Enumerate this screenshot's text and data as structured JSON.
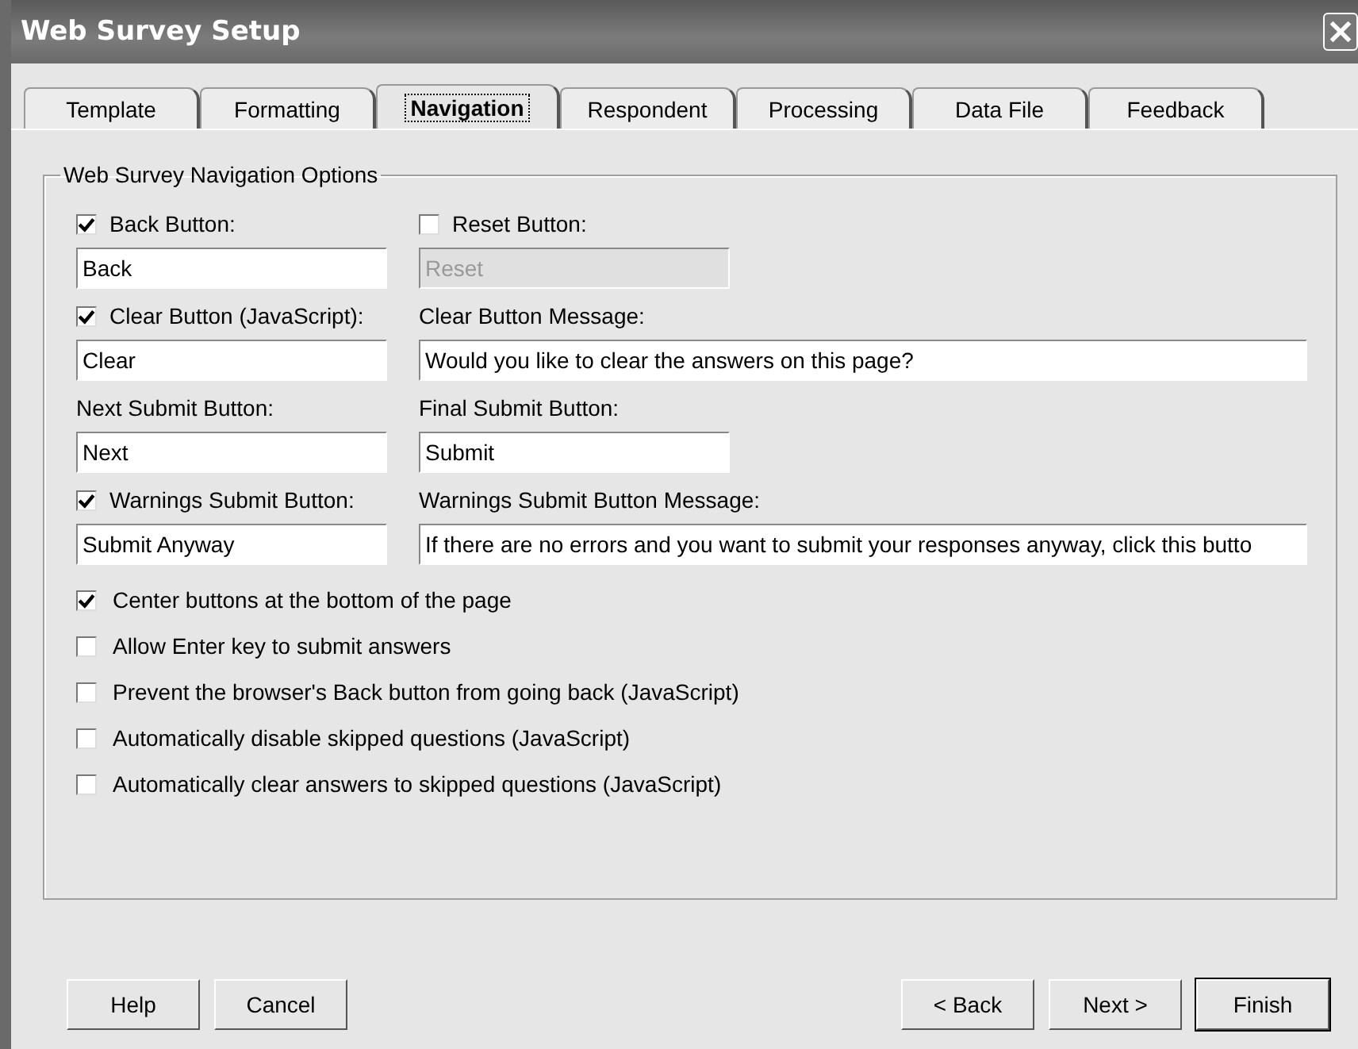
{
  "window": {
    "title": "Web Survey Setup"
  },
  "tabs": [
    {
      "label": "Template",
      "selected": false
    },
    {
      "label": "Formatting",
      "selected": false
    },
    {
      "label": "Navigation",
      "selected": true
    },
    {
      "label": "Respondent",
      "selected": false
    },
    {
      "label": "Processing",
      "selected": false
    },
    {
      "label": "Data File",
      "selected": false
    },
    {
      "label": "Feedback",
      "selected": false
    }
  ],
  "group": {
    "title": "Web Survey Navigation Options",
    "rows": [
      {
        "left": {
          "label": "Back Button:",
          "kind": "checkbox",
          "checked": true,
          "value": "Back",
          "disabled": false,
          "wide": false
        },
        "right": {
          "label": "Reset Button:",
          "kind": "checkbox",
          "checked": false,
          "value": "Reset",
          "disabled": true,
          "wide": false
        }
      },
      {
        "left": {
          "label": "Clear Button (JavaScript):",
          "kind": "checkbox",
          "checked": true,
          "value": "Clear",
          "disabled": false,
          "wide": false
        },
        "right": {
          "label": "Clear Button Message:",
          "kind": "label",
          "value": "Would you like to clear the answers on this page?",
          "disabled": false,
          "wide": true
        }
      },
      {
        "left": {
          "label": "Next Submit Button:",
          "kind": "label",
          "value": "Next",
          "disabled": false,
          "wide": false
        },
        "right": {
          "label": "Final Submit Button:",
          "kind": "label",
          "value": "Submit",
          "disabled": false,
          "wide": false
        }
      },
      {
        "left": {
          "label": "Warnings Submit Button:",
          "kind": "checkbox",
          "checked": true,
          "value": "Submit Anyway",
          "disabled": false,
          "wide": false
        },
        "right": {
          "label": "Warnings Submit Button Message:",
          "kind": "label",
          "value": "If there are no errors and you want to submit your responses anyway, click this butto",
          "disabled": false,
          "wide": true
        }
      }
    ],
    "options": [
      {
        "label": "Center buttons at the bottom of the page",
        "checked": true
      },
      {
        "label": "Allow Enter key to submit answers",
        "checked": false
      },
      {
        "label": "Prevent the browser's Back button from going back (JavaScript)",
        "checked": false
      },
      {
        "label": "Automatically disable skipped questions (JavaScript)",
        "checked": false
      },
      {
        "label": "Automatically clear answers to skipped questions (JavaScript)",
        "checked": false
      }
    ]
  },
  "buttons_left": [
    {
      "label": "Help",
      "default": false
    },
    {
      "label": "Cancel",
      "default": false
    }
  ],
  "buttons_right": [
    {
      "label": "< Back",
      "default": false
    },
    {
      "label": "Next >",
      "default": false
    },
    {
      "label": "Finish",
      "default": true
    }
  ]
}
